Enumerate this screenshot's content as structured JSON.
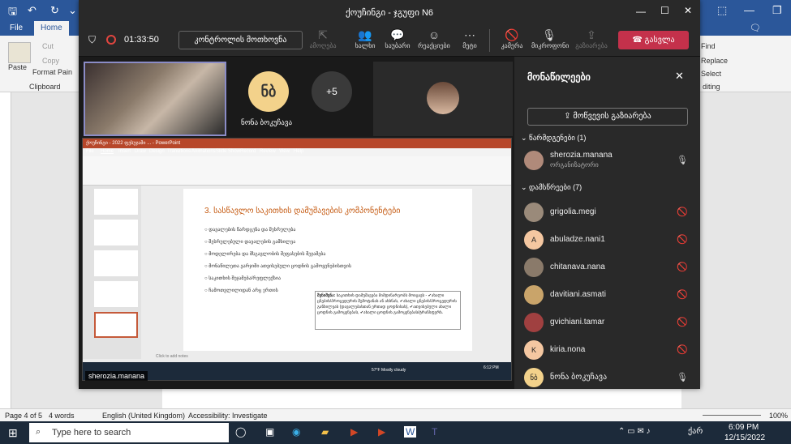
{
  "word": {
    "title_blurb": "",
    "tabs": [
      "File",
      "Home"
    ],
    "clipboard": {
      "paste": "Paste",
      "cut": "Cut",
      "copy": "Copy",
      "format_painter": "Format Pain",
      "group": "Clipboard"
    },
    "right": {
      "find": "Find",
      "replace": "Replace",
      "select": "Select",
      "editing": "diting"
    },
    "status": {
      "page": "Page 4 of 5",
      "words": "4 words",
      "lang": "English (United Kingdom)",
      "access": "Accessibility: Investigate",
      "zoom": "100%"
    }
  },
  "teams": {
    "title": "ქოუჩინგი - ჯგუფი N6",
    "timer": "01:33:50",
    "control_button": "კონტროლის მოთხოვნა",
    "toolbar": [
      "ამოღება",
      "ხალხი",
      "საუბარი",
      "რეაქციები",
      "მეტი",
      "კამერა",
      "მიკროფონი",
      "გაზიარება"
    ],
    "leave": "გასვლა",
    "tile_initials": "ნბ",
    "tile_name": "ნონა ბოკუჩავა",
    "more_count": "+5",
    "self_name": "sherozia.manana",
    "panel": {
      "title": "მონაწილეები",
      "share": "მოწვევის გაზიარება",
      "presenters": "წარმდგენები (1)",
      "attendees": "დამსწრეები (7)",
      "presenter": {
        "name": "sherozia.manana",
        "role": "ორგანიზატორი"
      },
      "people": [
        {
          "name": "grigolia.megi",
          "av": ""
        },
        {
          "name": "abuladze.nani1",
          "av": "A"
        },
        {
          "name": "chitanava.nana",
          "av": ""
        },
        {
          "name": "davitiani.asmati",
          "av": ""
        },
        {
          "name": "gvichiani.tamar",
          "av": ""
        },
        {
          "name": "kiria.nona",
          "av": "K"
        },
        {
          "name": "ნონა ბოკუჩავა",
          "av": "ნბ"
        }
      ]
    }
  },
  "slide": {
    "title": "3. სასწავლო საკითხის დამუშავების კომპონენტები",
    "bullets": [
      "დავალების წარდგენა და შესრულება",
      "შესრულებული დავალების გამხილვა",
      "მოდელირება და მსგავლობის შეფასების შეჯამება",
      "მონაწილეთა ვარჯიში ათვისებული ცოდნის გამოყენებისთვის",
      "საკითხის შეჯამება/რეფლექსია",
      "ჩამოთვლილიდან არც ერთის"
    ],
    "note_head": "შენიშვნა:",
    "note": "საკითხის დამუშავება მიმდინარეობს მოიცავს - ✔ახალი ცნების/პროცედურის შემოტანას ან ახსნას, ✔ახალი ცნების/პროცედურის განხილვას (დავალებასთან ერთად ცოდნისას), ✔ათვისებული ახალი ცოდნის გამოყენებას, ✔ახალი ცოდნის გამოყენებას/ტრანსფერს.",
    "notes_hint": "Click to add notes",
    "ppt_title": "ქოუჩინგი - 2022 ფესუჯამი ... - PowerPoint",
    "ppt_tabs": [
      "File",
      "Home",
      "Insert",
      "Draw",
      "Design",
      "Transitions",
      "Animations",
      "Slide Show",
      "Record",
      "Review",
      "View",
      "Help"
    ],
    "weather": "57°F Mostly cloudy",
    "ppt_clock": "6:12 PM"
  },
  "taskbar": {
    "search": "Type here to search",
    "time": "6:09 PM",
    "date": "12/15/2022",
    "lang": "ქარ"
  }
}
